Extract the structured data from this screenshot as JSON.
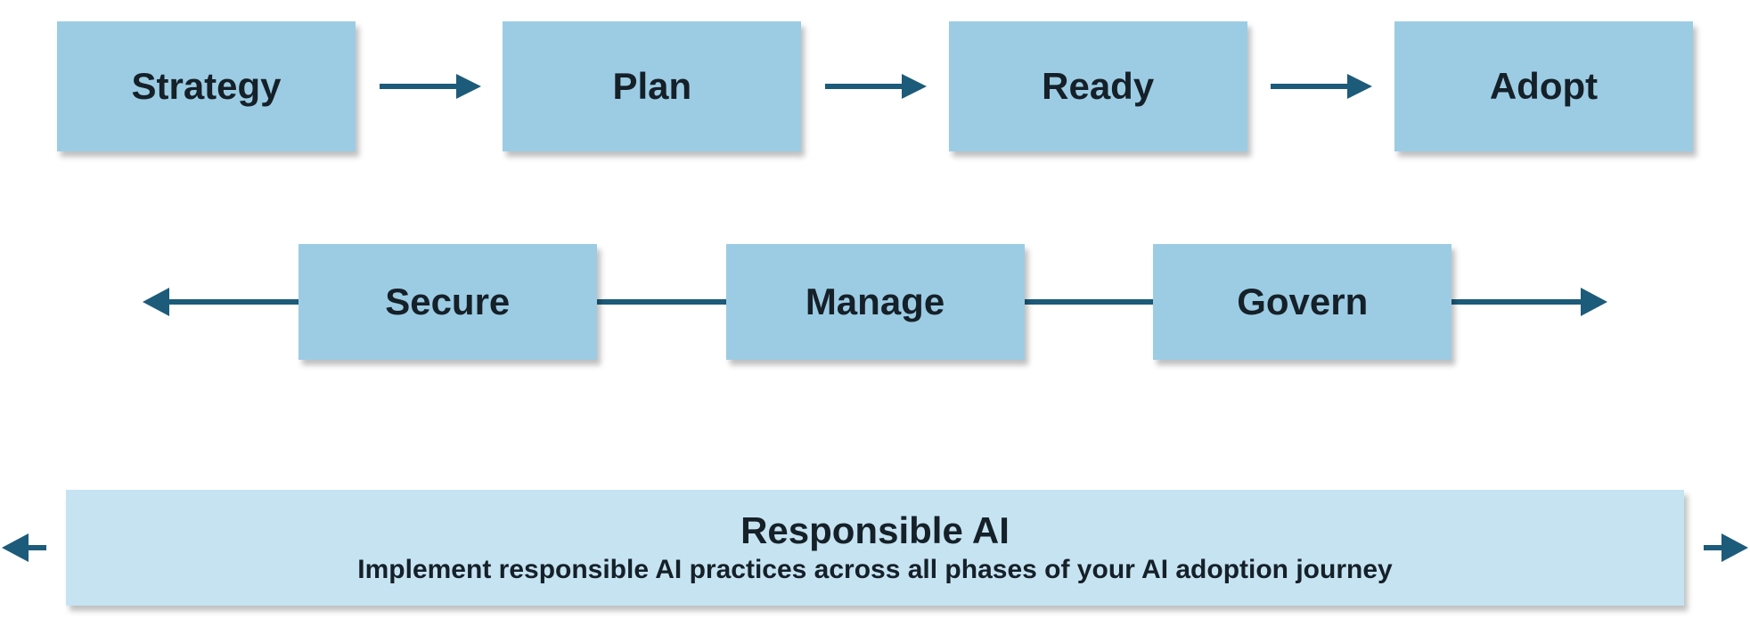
{
  "row1": {
    "boxes": [
      "Strategy",
      "Plan",
      "Ready",
      "Adopt"
    ]
  },
  "row2": {
    "boxes": [
      "Secure",
      "Manage",
      "Govern"
    ]
  },
  "banner": {
    "title": "Responsible AI",
    "subtitle": "Implement responsible AI practices across all phases of your AI adoption journey"
  },
  "colors": {
    "box_blue": "#9ccce4",
    "light_blue": "#c6e3f2",
    "arrow_dark": "#1d5b7a"
  }
}
